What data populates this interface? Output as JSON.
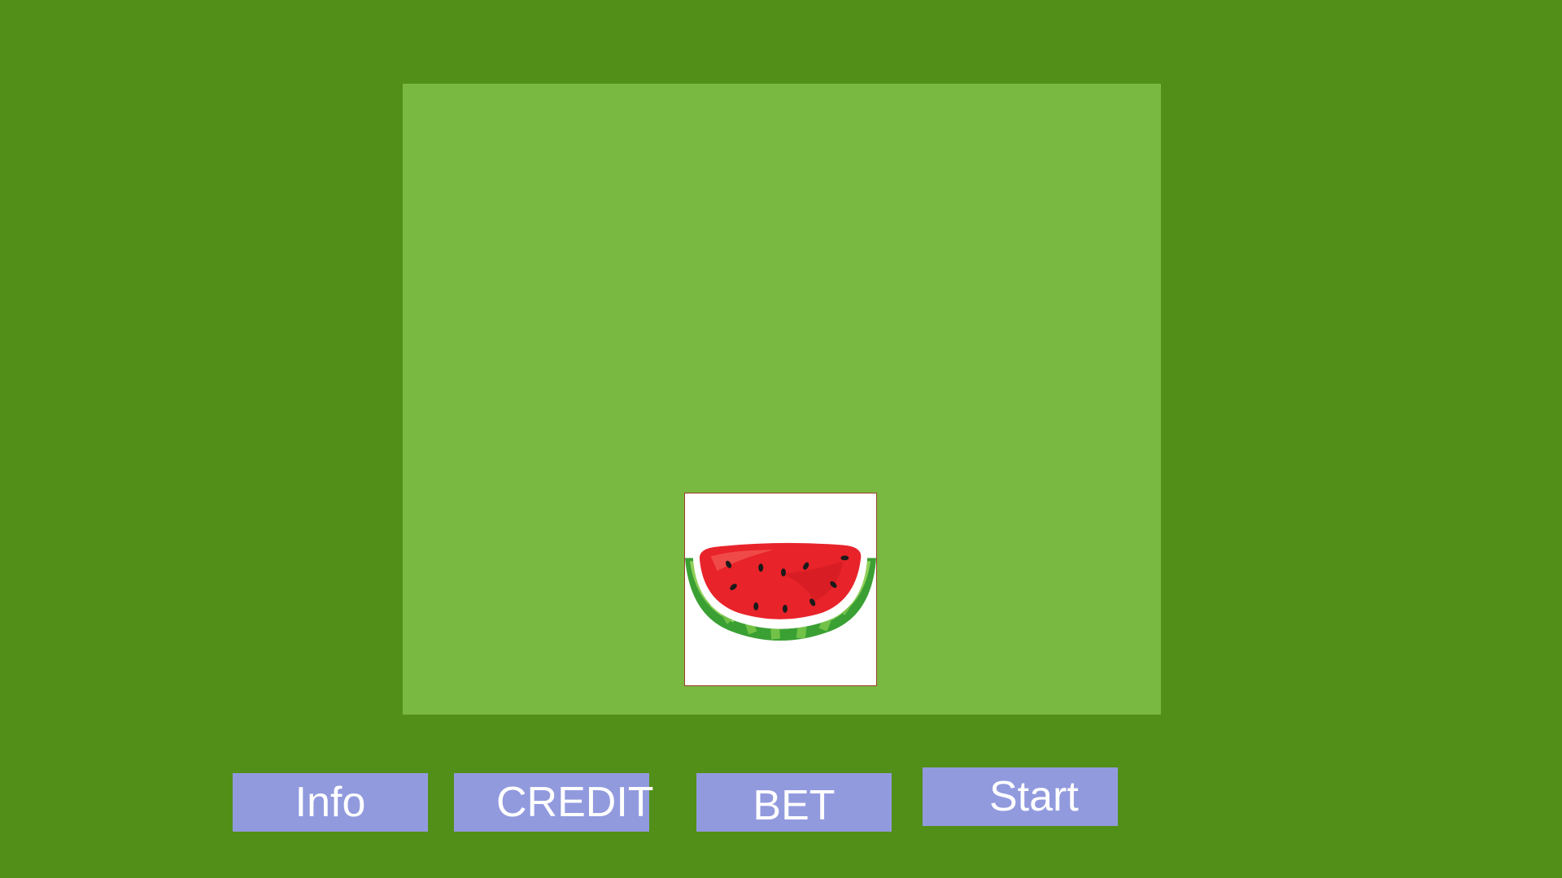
{
  "colors": {
    "background": "#528f18",
    "play_area": "#7ab941",
    "button": "#929ade",
    "button_text": "#ffffff",
    "tile_border": "#9b3a2a",
    "tile_background": "#ffffff"
  },
  "reel": {
    "symbol": "watermelon-icon"
  },
  "buttons": {
    "info_label": "Info",
    "credit_label": "CREDIT",
    "bet_label": "BET",
    "start_label": "Start"
  }
}
